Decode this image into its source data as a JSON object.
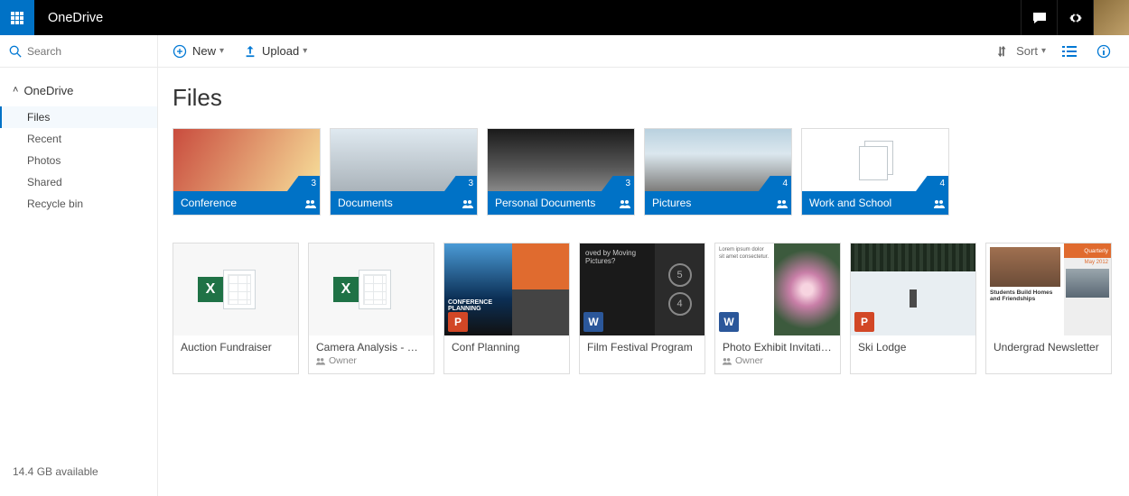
{
  "header": {
    "brand": "OneDrive"
  },
  "search": {
    "placeholder": "Search"
  },
  "sidebar": {
    "root": "OneDrive",
    "items": [
      {
        "label": "Files",
        "active": true
      },
      {
        "label": "Recent"
      },
      {
        "label": "Photos"
      },
      {
        "label": "Shared"
      },
      {
        "label": "Recycle bin"
      }
    ],
    "storage": "14.4 GB available"
  },
  "commands": {
    "new": "New",
    "upload": "Upload",
    "sort": "Sort"
  },
  "page": {
    "title": "Files"
  },
  "folders": [
    {
      "name": "Conference",
      "count": "3",
      "thumb": "th-conf"
    },
    {
      "name": "Documents",
      "count": "3",
      "thumb": "th-docs"
    },
    {
      "name": "Personal Documents",
      "count": "3",
      "thumb": "th-pers"
    },
    {
      "name": "Pictures",
      "count": "4",
      "thumb": "th-pic"
    },
    {
      "name": "Work and School",
      "count": "4",
      "thumb": "th-ws",
      "empty": true
    }
  ],
  "files": [
    {
      "name": "Auction Fundraiser",
      "type": "excel"
    },
    {
      "name": "Camera Analysis - Gen…",
      "type": "excel",
      "owner": "Owner"
    },
    {
      "name": "Conf Planning",
      "type": "powerpoint",
      "thumb": "ppt"
    },
    {
      "name": "Film Festival Program",
      "type": "word",
      "thumb": "film"
    },
    {
      "name": "Photo Exhibit Invitation",
      "type": "word",
      "thumb": "photo",
      "owner": "Owner"
    },
    {
      "name": "Ski Lodge",
      "type": "powerpoint",
      "thumb": "ski"
    },
    {
      "name": "Undergrad Newsletter",
      "type": "none",
      "thumb": "news"
    }
  ],
  "news": {
    "headline": "Students Build Homes and Friendships",
    "corner": "Quarterly",
    "date": "May 2012"
  },
  "film": {
    "line": "oved by Moving Pictures?"
  },
  "badges": {
    "word_letter": "W",
    "ppt_letter": "P",
    "excel_letter": "X"
  }
}
